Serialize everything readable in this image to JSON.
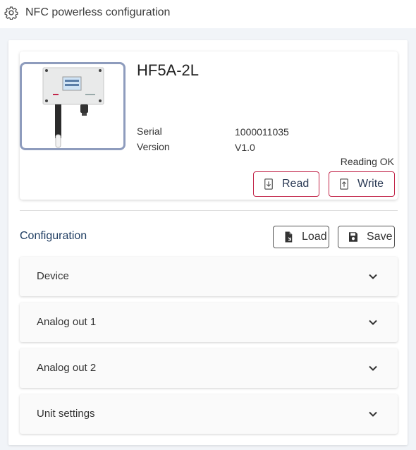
{
  "header": {
    "title": "NFC powerless configuration",
    "icon": "gear-icon"
  },
  "device": {
    "name": "HF5A-2L",
    "serial_label": "Serial",
    "serial_value": "1000011035",
    "version_label": "Version",
    "version_value": "V1.0",
    "status": "Reading OK",
    "read_label": "Read",
    "write_label": "Write"
  },
  "configuration": {
    "title": "Configuration",
    "load_label": "Load",
    "save_label": "Save",
    "panels": [
      "Device",
      "Analog out 1",
      "Analog out 2",
      "Unit settings"
    ]
  },
  "colors": {
    "accent": "#c2264a",
    "title_blue": "#1f3d62",
    "image_border": "#8e9cbd"
  }
}
